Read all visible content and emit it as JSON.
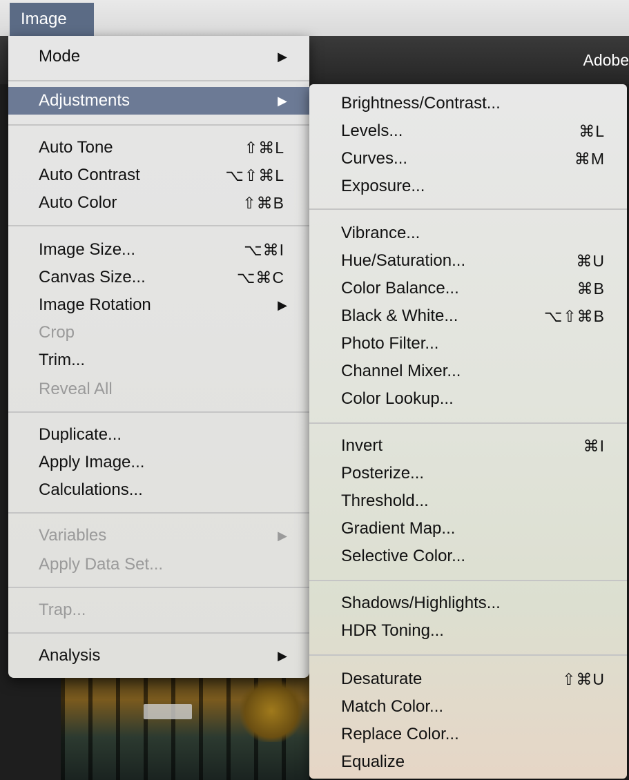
{
  "menubar": {
    "title": "Image"
  },
  "app": {
    "title": "Adobe"
  },
  "image_menu": {
    "items": [
      {
        "label": "Mode",
        "arrow": "▶"
      },
      {
        "label": "Adjustments",
        "arrow": "▶"
      },
      {
        "label": "Auto Tone",
        "shortcut": "⇧⌘L"
      },
      {
        "label": "Auto Contrast",
        "shortcut": "⌥⇧⌘L"
      },
      {
        "label": "Auto Color",
        "shortcut": "⇧⌘B"
      },
      {
        "label": "Image Size...",
        "shortcut": "⌥⌘I"
      },
      {
        "label": "Canvas Size...",
        "shortcut": "⌥⌘C"
      },
      {
        "label": "Image Rotation",
        "arrow": "▶"
      },
      {
        "label": "Crop"
      },
      {
        "label": "Trim..."
      },
      {
        "label": "Reveal All"
      },
      {
        "label": "Duplicate..."
      },
      {
        "label": "Apply Image..."
      },
      {
        "label": "Calculations..."
      },
      {
        "label": "Variables",
        "arrow": "▶"
      },
      {
        "label": "Apply Data Set..."
      },
      {
        "label": "Trap..."
      },
      {
        "label": "Analysis",
        "arrow": "▶"
      }
    ]
  },
  "adjustments_menu": {
    "items": [
      {
        "label": "Brightness/Contrast..."
      },
      {
        "label": "Levels...",
        "shortcut": "⌘L"
      },
      {
        "label": "Curves...",
        "shortcut": "⌘M"
      },
      {
        "label": "Exposure..."
      },
      {
        "label": "Vibrance..."
      },
      {
        "label": "Hue/Saturation...",
        "shortcut": "⌘U"
      },
      {
        "label": "Color Balance...",
        "shortcut": "⌘B"
      },
      {
        "label": "Black & White...",
        "shortcut": "⌥⇧⌘B"
      },
      {
        "label": "Photo Filter..."
      },
      {
        "label": "Channel Mixer..."
      },
      {
        "label": "Color Lookup..."
      },
      {
        "label": "Invert",
        "shortcut": "⌘I"
      },
      {
        "label": "Posterize..."
      },
      {
        "label": "Threshold..."
      },
      {
        "label": "Gradient Map..."
      },
      {
        "label": "Selective Color..."
      },
      {
        "label": "Shadows/Highlights..."
      },
      {
        "label": "HDR Toning..."
      },
      {
        "label": "Desaturate",
        "shortcut": "⇧⌘U"
      },
      {
        "label": "Match Color..."
      },
      {
        "label": "Replace Color..."
      },
      {
        "label": "Equalize"
      }
    ]
  }
}
